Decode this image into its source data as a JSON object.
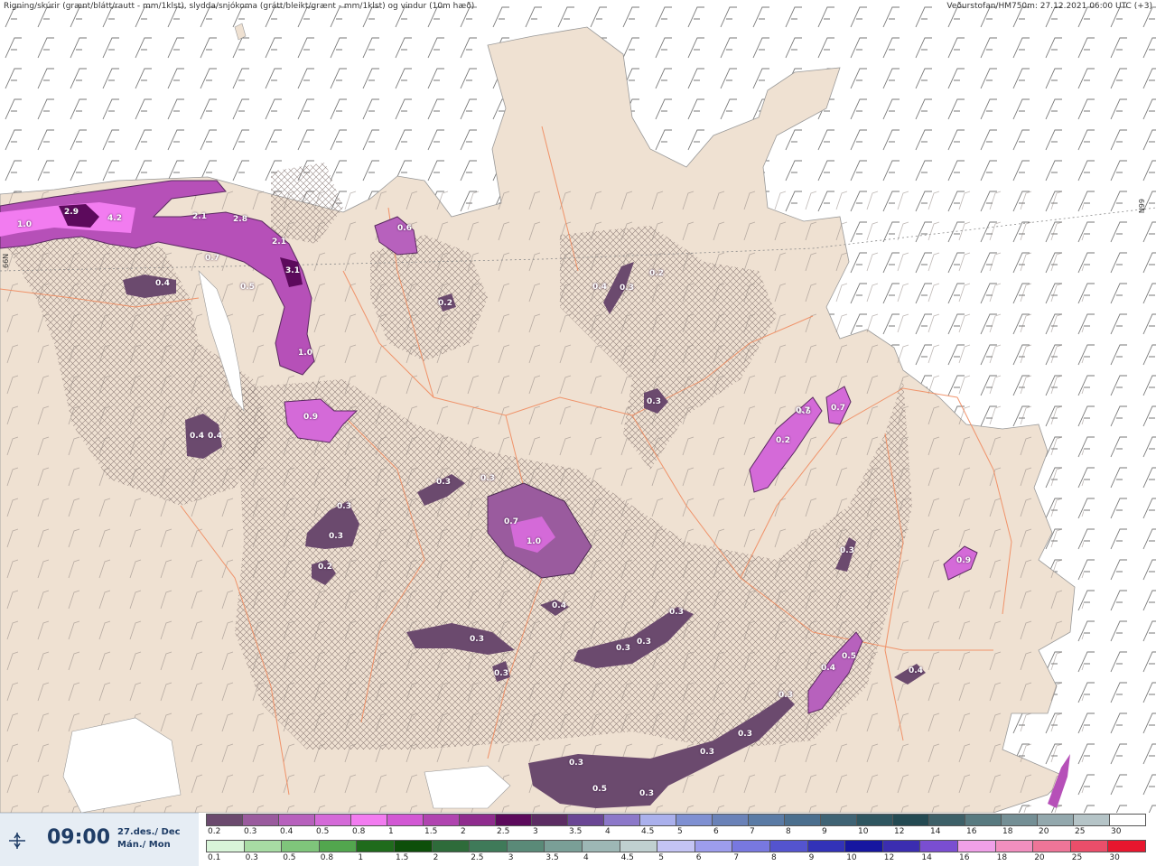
{
  "header": {
    "left": "Rigning/skúrir (grænt/blátt/rautt - mm/1klst), slydda/snjókoma (grátt/bleikt/grænt - mm/1klst) og vindur (10m hæð)",
    "right": "Veðurstofan/HM750m: 27.12.2021 06:00 UTC (+3)"
  },
  "latitude_label": "66N",
  "time": "09:00",
  "date_line1": "27.des./ Dec",
  "date_line2": "Mán./ Mon",
  "labels": [
    {
      "t": "1.0"
    },
    {
      "t": "2.9"
    },
    {
      "t": "4.2"
    },
    {
      "t": "2.1"
    },
    {
      "t": "2.8"
    },
    {
      "t": "2.1"
    },
    {
      "t": "0.7"
    },
    {
      "t": "3.1"
    },
    {
      "t": "0.4"
    },
    {
      "t": "0.5"
    },
    {
      "t": "1.0"
    },
    {
      "t": "0.6"
    },
    {
      "t": "0.2"
    },
    {
      "t": "0.9"
    },
    {
      "t": "0.4"
    },
    {
      "t": "0.4"
    },
    {
      "t": "0.4"
    },
    {
      "t": "0.3"
    },
    {
      "t": "0.2"
    },
    {
      "t": "0.3"
    },
    {
      "t": "0.3"
    },
    {
      "t": "0.7"
    },
    {
      "t": "1.0"
    },
    {
      "t": "0.7"
    },
    {
      "t": "0.2"
    },
    {
      "t": "0.3"
    },
    {
      "t": "0.3"
    },
    {
      "t": "0.3"
    },
    {
      "t": "0.2"
    },
    {
      "t": "0.5"
    },
    {
      "t": "0.7"
    },
    {
      "t": "0.4"
    },
    {
      "t": "0.3"
    },
    {
      "t": "0.3"
    },
    {
      "t": "0.3"
    },
    {
      "t": "0.3"
    },
    {
      "t": "0.3"
    },
    {
      "t": "0.3"
    },
    {
      "t": "0.5"
    },
    {
      "t": "0.5"
    },
    {
      "t": "0.4"
    },
    {
      "t": "0.9"
    },
    {
      "t": "0.3"
    },
    {
      "t": "0.3"
    },
    {
      "t": "0.3"
    },
    {
      "t": "0.3"
    },
    {
      "t": "0.3"
    },
    {
      "t": "0.4"
    }
  ],
  "legend_snow": {
    "values": [
      "0.2",
      "0.3",
      "0.4",
      "0.5",
      "0.8",
      "1",
      "1.5",
      "2",
      "2.5",
      "3",
      "3.5",
      "4",
      "4.5",
      "5",
      "6",
      "7",
      "8",
      "9",
      "10",
      "12",
      "14",
      "16",
      "18",
      "20",
      "25",
      "30"
    ],
    "colors": [
      "#6b4a6e",
      "#9a5b9e",
      "#b761bd",
      "#d46ad8",
      "#f27cf0",
      "#d258d4",
      "#b044b0",
      "#8f2c8e",
      "#5c0a5c",
      "#5c2d63",
      "#6a4694",
      "#8c78c9",
      "#aab0ec",
      "#7f90d2",
      "#6a82b8",
      "#5a7ba5",
      "#4b6f8e",
      "#3f6374",
      "#2f5660",
      "#244a52",
      "#3d6068",
      "#587a80",
      "#748f95",
      "#93a8ad",
      "#b5c4c7",
      "#ffffff"
    ]
  },
  "legend_rain": {
    "values": [
      "0.1",
      "0.3",
      "0.5",
      "0.8",
      "1",
      "1.5",
      "2",
      "2.5",
      "3",
      "3.5",
      "4",
      "4.5",
      "5",
      "6",
      "7",
      "8",
      "9",
      "10",
      "12",
      "14",
      "16",
      "18",
      "20",
      "25",
      "30"
    ],
    "colors": [
      "#d9f5d9",
      "#a8dca4",
      "#7fc57b",
      "#52a64e",
      "#1f6b1c",
      "#0d4f0a",
      "#2e6b3a",
      "#3f7a59",
      "#5a8a78",
      "#7a9f97",
      "#9db7b5",
      "#c0d0d0",
      "#c4c4f4",
      "#9d9ded",
      "#7878e0",
      "#5454cf",
      "#3232b8",
      "#1616a0",
      "#3b2db0",
      "#7a4ed1",
      "#f0a0e8",
      "#f28fbf",
      "#ee7598",
      "#eb4e6a",
      "#e8162e"
    ]
  }
}
